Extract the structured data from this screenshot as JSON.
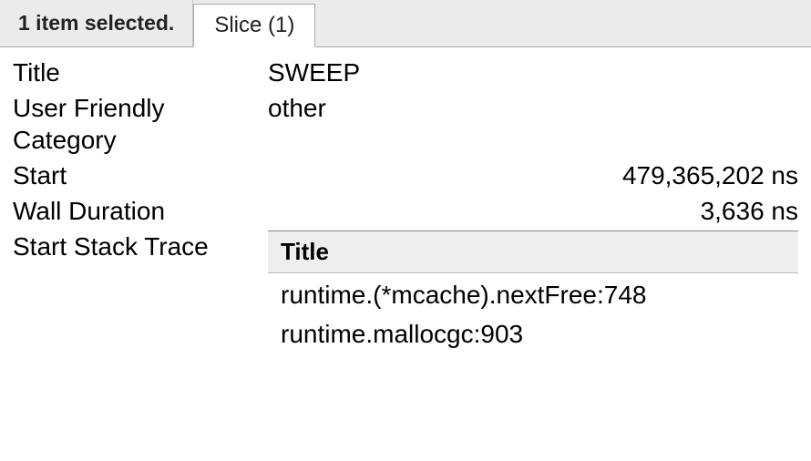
{
  "tabbar": {
    "selection_text": "1 item selected.",
    "tab_label": "Slice (1)"
  },
  "details": {
    "labels": {
      "title": "Title",
      "category": "User Friendly Category",
      "start": "Start",
      "wall_duration": "Wall Duration",
      "stack": "Start Stack Trace"
    },
    "title": "SWEEP",
    "category": "other",
    "start": "479,365,202 ns",
    "wall_duration": "3,636 ns",
    "stack_header": "Title",
    "stack_frames": [
      "runtime.(*mcache).nextFree:748",
      "runtime.mallocgc:903"
    ]
  }
}
